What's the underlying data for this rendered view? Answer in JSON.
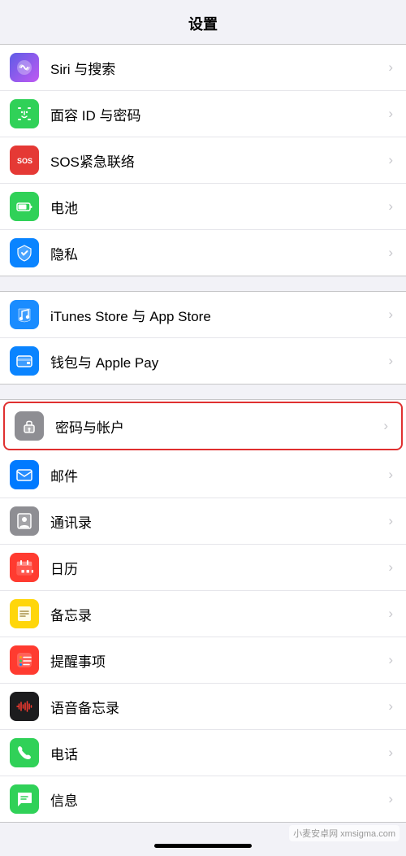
{
  "page": {
    "title": "设置"
  },
  "sections": [
    {
      "id": "section1",
      "rows": [
        {
          "id": "siri",
          "label": "Siri 与搜索",
          "iconBg": "bg-siri",
          "iconType": "siri"
        },
        {
          "id": "faceid",
          "label": "面容 ID 与密码",
          "iconBg": "bg-faceid",
          "iconType": "faceid"
        },
        {
          "id": "sos",
          "label": "SOS紧急联络",
          "iconBg": "bg-sos",
          "iconType": "sos"
        },
        {
          "id": "battery",
          "label": "电池",
          "iconBg": "bg-battery",
          "iconType": "battery"
        },
        {
          "id": "privacy",
          "label": "隐私",
          "iconBg": "bg-privacy",
          "iconType": "privacy"
        }
      ]
    },
    {
      "id": "section2",
      "rows": [
        {
          "id": "itunes",
          "label": "iTunes Store 与 App Store",
          "iconBg": "bg-itunes",
          "iconType": "itunes"
        },
        {
          "id": "wallet",
          "label": "钱包与 Apple Pay",
          "iconBg": "bg-wallet",
          "iconType": "wallet"
        }
      ]
    },
    {
      "id": "section3",
      "rows": [
        {
          "id": "passwords",
          "label": "密码与帐户",
          "iconBg": "bg-passwords",
          "iconType": "passwords",
          "highlighted": true
        },
        {
          "id": "mail",
          "label": "邮件",
          "iconBg": "bg-mail",
          "iconType": "mail"
        },
        {
          "id": "contacts",
          "label": "通讯录",
          "iconBg": "bg-contacts",
          "iconType": "contacts"
        },
        {
          "id": "calendar",
          "label": "日历",
          "iconBg": "bg-calendar",
          "iconType": "calendar"
        },
        {
          "id": "notes",
          "label": "备忘录",
          "iconBg": "bg-notes",
          "iconType": "notes"
        },
        {
          "id": "reminders",
          "label": "提醒事项",
          "iconBg": "bg-reminders",
          "iconType": "reminders"
        },
        {
          "id": "voicememo",
          "label": "语音备忘录",
          "iconBg": "bg-voicememo",
          "iconType": "voicememo"
        },
        {
          "id": "phone",
          "label": "电话",
          "iconBg": "bg-phone",
          "iconType": "phone"
        },
        {
          "id": "messages",
          "label": "信息",
          "iconBg": "bg-messages",
          "iconType": "messages"
        }
      ]
    }
  ],
  "watermark": "小麦安卓网 xmsigma.com"
}
